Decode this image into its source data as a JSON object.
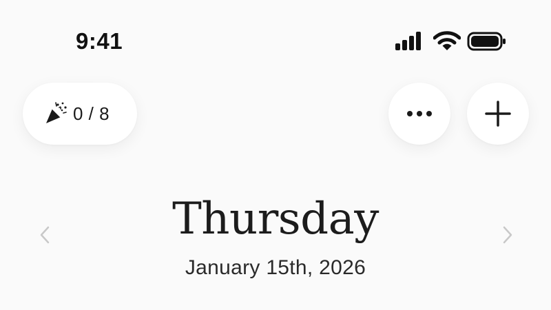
{
  "status_bar": {
    "time": "9:41",
    "icons": [
      "signal-icon",
      "wifi-icon",
      "battery-icon"
    ]
  },
  "toolbar": {
    "progress_icon": "party-popper-icon",
    "progress_text": "0 / 8",
    "progress_completed": 0,
    "progress_total": 8,
    "more_icon": "ellipsis-icon",
    "add_icon": "plus-icon"
  },
  "day_header": {
    "day_name": "Thursday",
    "date": "January 15th, 2026",
    "prev_icon": "chevron-left-icon",
    "next_icon": "chevron-right-icon"
  },
  "colors": {
    "background": "#fafafa",
    "surface": "#ffffff",
    "text": "#1a1a1a",
    "arrow": "#c8c8c8"
  }
}
